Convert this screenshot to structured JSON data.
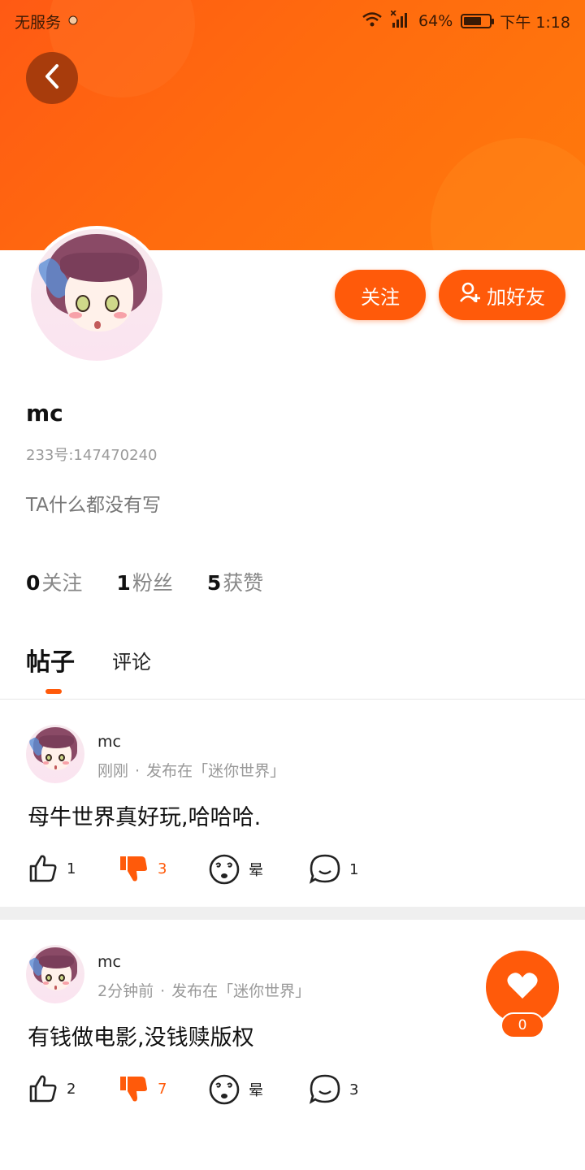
{
  "status_bar": {
    "carrier": "无服务",
    "battery": "64%",
    "time": "下午 1:18"
  },
  "header": {
    "back_icon": "chevron-left-icon",
    "follow_label": "关注",
    "add_friend_label": "加好友"
  },
  "profile": {
    "name": "mc",
    "id_line": "233号:147470240",
    "bio": "TA什么都没有写",
    "stats": [
      {
        "value": "0",
        "label": "关注"
      },
      {
        "value": "1",
        "label": "粉丝"
      },
      {
        "value": "5",
        "label": "获赞"
      }
    ]
  },
  "tabs": [
    {
      "label": "帖子",
      "active": true
    },
    {
      "label": "评论",
      "active": false
    }
  ],
  "posts": [
    {
      "author": "mc",
      "time": "刚刚",
      "dot": "·",
      "board": "发布在「迷你世界」",
      "text": "母牛世界真好玩,哈哈哈.",
      "likes": "1",
      "dislikes": "3",
      "emoji_label": "晕",
      "comments": "1"
    },
    {
      "author": "mc",
      "time": "2分钟前",
      "dot": "·",
      "board": "发布在「迷你世界」",
      "text": "有钱做电影,没钱赎版权",
      "likes": "2",
      "dislikes": "7",
      "emoji_label": "晕",
      "comments": "3"
    }
  ],
  "fab": {
    "icon": "heart-icon",
    "count": "0"
  },
  "colors": {
    "accent": "#ff5a0a",
    "banner": "#ff6b0e"
  }
}
